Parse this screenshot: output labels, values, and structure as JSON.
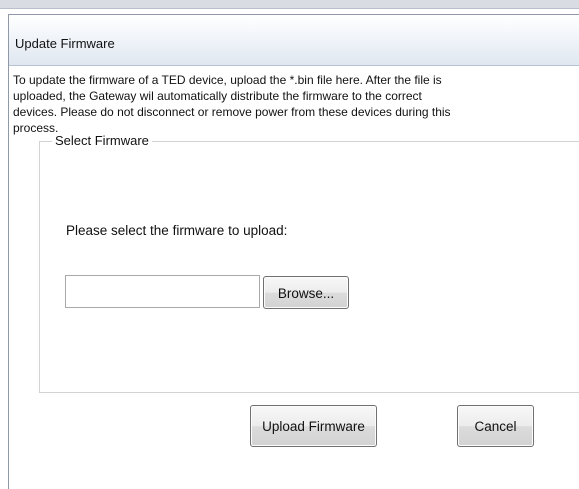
{
  "dialog": {
    "title": "Update Firmware",
    "description_lines": [
      "To update the firmware of a TED device, upload the *.bin file here. After the file is",
      "uploaded, the Gateway wil automatically distribute the firmware to the correct",
      "devices. Please do not disconnect or remove power from these devices during this",
      "process."
    ]
  },
  "firmware_section": {
    "legend": "Select Firmware",
    "prompt": "Please select the firmware to upload:",
    "file_input_value": "",
    "browse_label": "Browse..."
  },
  "actions": {
    "upload_label": "Upload Firmware",
    "cancel_label": "Cancel"
  }
}
